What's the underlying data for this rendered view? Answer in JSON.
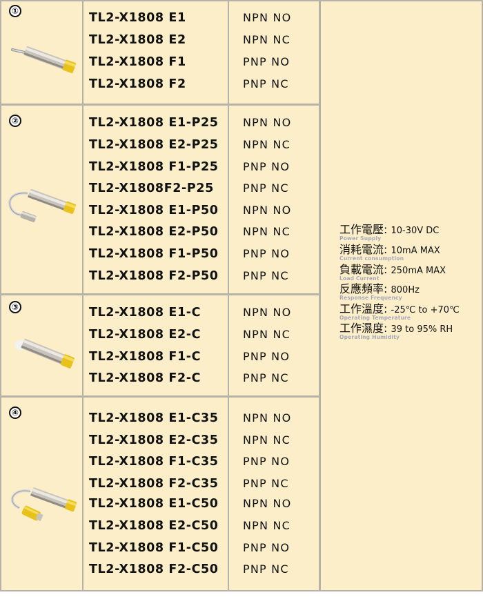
{
  "groups": [
    {
      "number": "①",
      "image_icon": "prox-sensor-icon",
      "rows": [
        {
          "model": "TL2-X1808 E1",
          "type": "NPN NO"
        },
        {
          "model": "TL2-X1808 E2",
          "type": "NPN NC"
        },
        {
          "model": "TL2-X1808 F1",
          "type": "PNP NO"
        },
        {
          "model": "TL2-X1808 F2",
          "type": "PNP NC"
        }
      ]
    },
    {
      "number": "②",
      "image_icon": "prox-sensor-connector-icon",
      "rows": [
        {
          "model": "TL2-X1808 E1-P25",
          "type": "NPN NO"
        },
        {
          "model": "TL2-X1808 E2-P25",
          "type": "NPN NC"
        },
        {
          "model": "TL2-X1808 F1-P25",
          "type": "PNP NO"
        },
        {
          "model": "TL2-X1808F2-P25",
          "type": "PNP NC"
        },
        {
          "model": "TL2-X1808 E1-P50",
          "type": "NPN NO"
        },
        {
          "model": "TL2-X1808 E2-P50",
          "type": "NPN NC"
        },
        {
          "model": "TL2-X1808 F1-P50",
          "type": "PNP NO"
        },
        {
          "model": "TL2-X1808 F2-P50",
          "type": "PNP NC"
        }
      ]
    },
    {
      "number": "③",
      "image_icon": "prox-sensor-cable-icon",
      "rows": [
        {
          "model": "TL2-X1808 E1-C",
          "type": "NPN NO"
        },
        {
          "model": "TL2-X1808 E2-C",
          "type": "NPN NC"
        },
        {
          "model": "TL2-X1808 F1-C",
          "type": "PNP NO"
        },
        {
          "model": "TL2-X1808 F2-C",
          "type": "PNP NC"
        }
      ]
    },
    {
      "number": "④",
      "image_icon": "prox-sensor-plug-icon",
      "rows": [
        {
          "model": "TL2-X1808 E1-C35",
          "type": "NPN NO"
        },
        {
          "model": "TL2-X1808 E2-C35",
          "type": "NPN NC"
        },
        {
          "model": "TL2-X1808 F1-C35",
          "type": "PNP NO"
        },
        {
          "model": "TL2-X1808 F2-C35",
          "type": "PNP NC"
        },
        {
          "model": "TL2-X1808 E1-C50",
          "type": "NPN NO"
        },
        {
          "model": "TL2-X1808 E2-C50",
          "type": "NPN NC"
        },
        {
          "model": "TL2-X1808 F1-C50",
          "type": "PNP NO"
        },
        {
          "model": "TL2-X1808 F2-C50",
          "type": "PNP NC"
        }
      ]
    }
  ],
  "specs": [
    {
      "label_zh": "工作電壓",
      "label_en": "Power Supply",
      "value": "10-30V DC"
    },
    {
      "label_zh": "消耗電流",
      "label_en": "Current consumption",
      "value": "10mA MAX"
    },
    {
      "label_zh": "負載電流",
      "label_en": "Load Current",
      "value": "250mA MAX"
    },
    {
      "label_zh": "反應頻率",
      "label_en": "Response Frequency",
      "value": "800Hz"
    },
    {
      "label_zh": "工作溫度",
      "label_en": "Operating Temperature",
      "value": "-25℃ to +70℃"
    },
    {
      "label_zh": "工作濕度",
      "label_en": "Operating Humidity",
      "value": "39 to 95% RH"
    }
  ],
  "colors": {
    "cell_bg": "#fbeec9",
    "grid_line": "#b7b2a7",
    "sensor_cap": "#e8c21a",
    "sensor_body": "#c9c4bb"
  }
}
